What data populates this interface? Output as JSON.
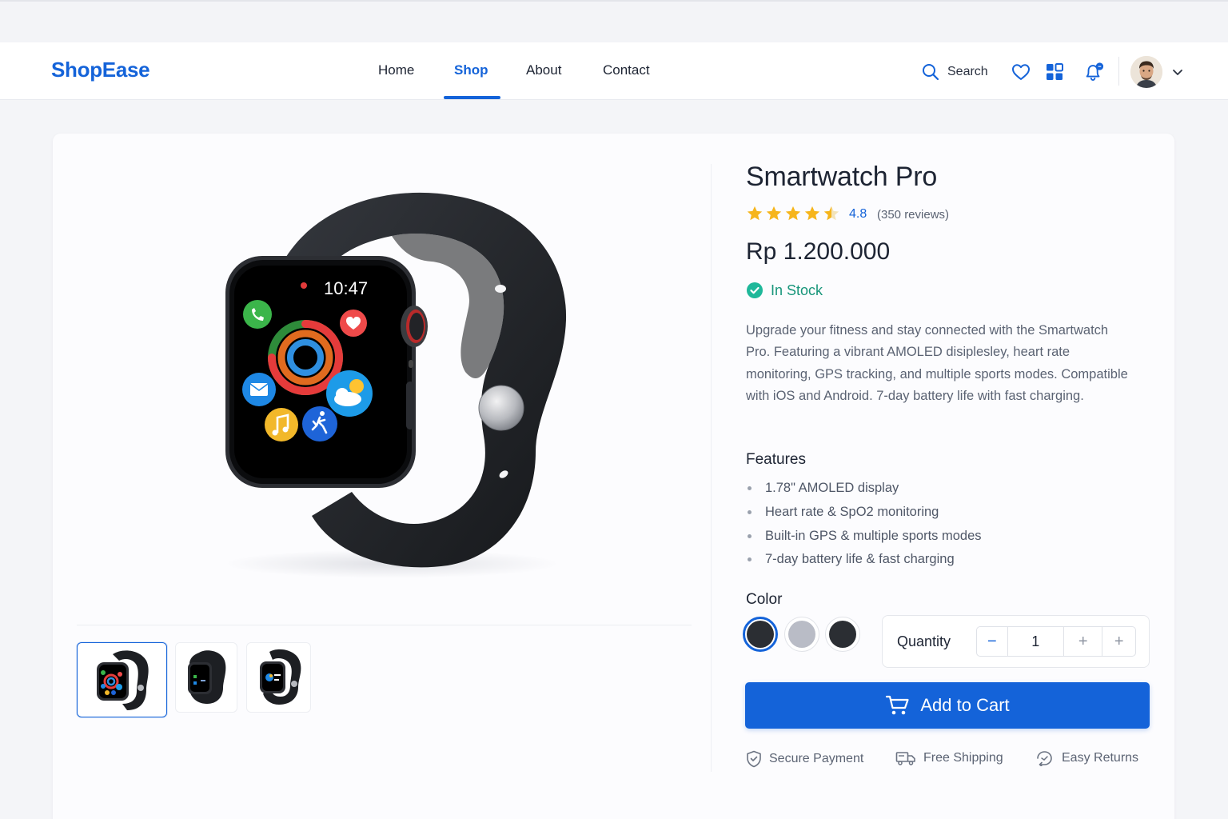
{
  "brand": "ShopEase",
  "nav": {
    "links": [
      "Home",
      "Shop",
      "About",
      "Contact"
    ],
    "active": "Shop",
    "search_label": "Search"
  },
  "product": {
    "title": "Smartwatch Pro",
    "rating": "4.8",
    "rating_value": 4.5,
    "reviews": "(350 reviews)",
    "price": "Rp 1.200.000",
    "stock": "In Stock",
    "description": "Upgrade your fitness and stay connected with the Smartwatch Pro. Featuring a vibrant AMOLED disiplesley, heart rate monitoring, GPS tracking, and multiple sports modes. Compatible with iOS and Android. 7-day battery life with fast charging.",
    "watch_time": "10:47",
    "features_heading": "Features",
    "features": [
      "1.78\" AMOLED display",
      "Heart rate & SpO2 monitoring",
      "Built-in GPS & multiple sports modes",
      "7-day battery life & fast charging"
    ],
    "color_heading": "Color",
    "colors": [
      "#2b2e33",
      "#b9bcc6",
      "#2b2e33"
    ],
    "selected_color_index": 0,
    "quantity_label": "Quantity",
    "quantity": "1",
    "cart_label": "Add to Cart",
    "perks": [
      "Secure Payment",
      "Free Shipping",
      "Easy Returns"
    ]
  },
  "colors": {
    "accent": "#1463d9",
    "success": "#17957a",
    "star": "#f6b51b"
  }
}
